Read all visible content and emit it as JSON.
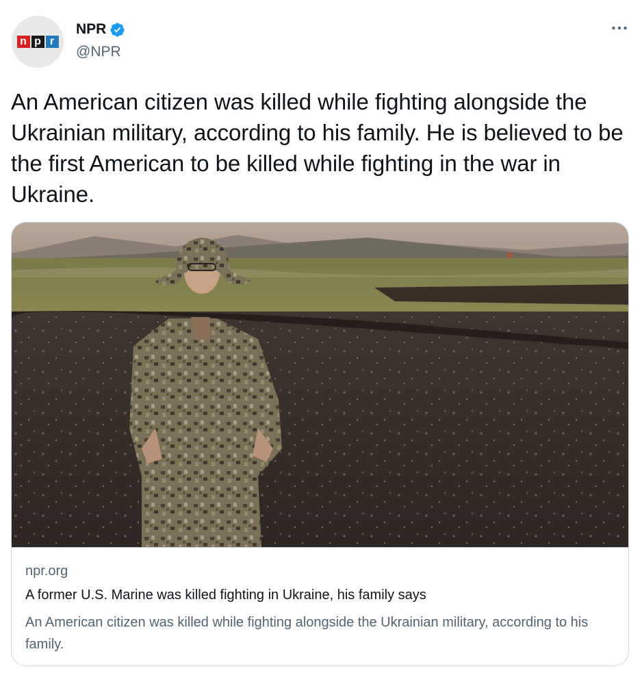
{
  "author": {
    "display_name": "NPR",
    "handle": "@NPR",
    "verified": true,
    "avatar_logo_letters": [
      "n",
      "p",
      "r"
    ],
    "avatar_icon": "npr-logo-icon",
    "verified_icon": "verified-badge-icon",
    "more_icon": "more-options-icon"
  },
  "tweet": {
    "text": "An American citizen was killed while fighting alongside the Ukrainian military, according to his family. He is believed to be the first American to be killed while fighting in the war in Ukraine."
  },
  "card": {
    "domain": "npr.org",
    "title": "A former U.S. Marine was killed fighting in Ukraine, his family says",
    "description": "An American citizen was killed while fighting alongside the Ukrainian military, according to his family.",
    "image_icon": "photo-soldier-in-field"
  },
  "colors": {
    "npr_red": "#d62021",
    "npr_black": "#1a1a1a",
    "npr_blue": "#237bbd",
    "verified_blue": "#1d9bf0",
    "secondary_text": "#536471",
    "border": "#cfd9de"
  }
}
